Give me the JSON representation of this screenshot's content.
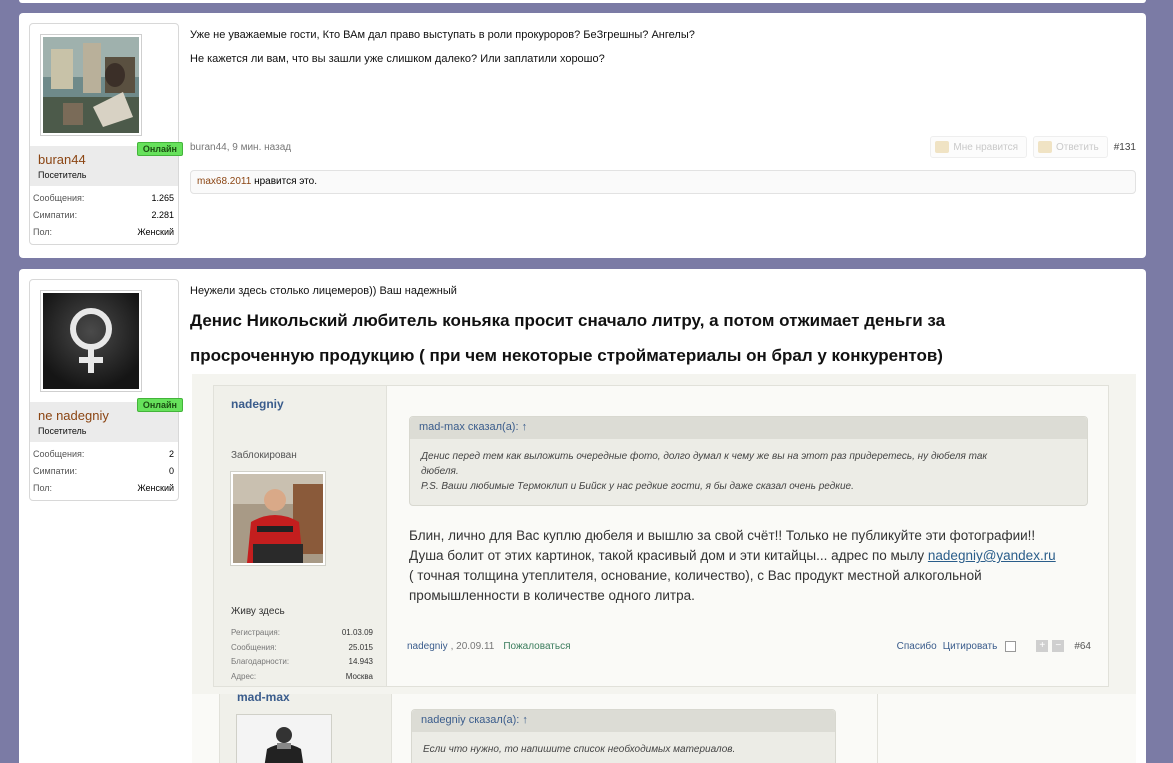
{
  "posts": [
    {
      "user": {
        "name": "buran44",
        "title": "Посетитель",
        "online": "Онлайн",
        "stats": [
          {
            "label": "Сообщения:",
            "value": "1.265"
          },
          {
            "label": "Симпатии:",
            "value": "2.281"
          },
          {
            "label": "Пол:",
            "value": "Женский"
          }
        ]
      },
      "lines": [
        "Уже не уважаемые гости, Кто ВАм дал право выступать в роли прокуроров? БеЗгрешны? Ангелы?",
        "Не кажется ли вам, что вы зашли уже слишком далеко? Или заплатили хорошо?"
      ],
      "meta": "buran44, 9 мин. назад",
      "like_label": "Мне нравится",
      "reply_label": "Ответить",
      "number": "#131",
      "likes": {
        "user": "max68.2011",
        "text": " нравится это."
      }
    },
    {
      "user": {
        "name": "ne nadegniy",
        "title": "Посетитель",
        "online": "Онлайн",
        "stats": [
          {
            "label": "Сообщения:",
            "value": "2"
          },
          {
            "label": "Симпатии:",
            "value": "0"
          },
          {
            "label": "Пол:",
            "value": "Женский"
          }
        ]
      },
      "intro": "Неужели здесь столько лицемеров)) Ваш надежный",
      "bold_lines": [
        "Денис Никольский любитель коньяка просит сначало литру, а потом отжимает деньги за",
        "просроченную продукцию ( при чем некоторые стройматериалы он брал у конкурентов)"
      ]
    }
  ],
  "embedded": {
    "username": "nadegniy",
    "status": "Заблокирован",
    "live": "Живу здесь",
    "stats": [
      {
        "label": "Регистрация:",
        "value": "01.03.09"
      },
      {
        "label": "Сообщения:",
        "value": "25.015"
      },
      {
        "label": "Благодарности:",
        "value": "14.943"
      },
      {
        "label": "Адрес:",
        "value": "Москва"
      }
    ],
    "quote_head": "mad-max сказал(а): ↑",
    "quote_lines": [
      "Денис перед тем как выложить очередные фото, долго думал к чему же вы на этот раз придеретесь, ну дюбеля так",
      "дюбеля.",
      "P.S. Ваши любимые Термоклип и Бийск у нас редкие гости, я бы даже сказал очень редкие."
    ],
    "text1": "Блин, лично для Вас куплю дюбеля и вышлю за свой счёт!! Только не публикуйте эти фотографии!!",
    "text2": "Душа болит от этих картинок, такой красивый дом и эти китайцы... адрес по мылу ",
    "email": "nadegniy@yandex.ru",
    "text3": "( точная толщина утеплителя, основание, количество), с Вас продукт местной алкогольной",
    "text4": "промышленности в количестве одного литра.",
    "foot_author": "nadegniy",
    "foot_date": ", 20.09.11",
    "foot_report": "Пожаловаться",
    "foot_thanks": "Спасибо",
    "foot_quote": "Цитировать",
    "foot_plus": "+",
    "foot_minus": "−",
    "foot_num": "#64"
  },
  "embedded2": {
    "username": "mad-max",
    "quote_head": "nadegniy сказал(а): ↑",
    "quote_line1": "Если что нужно, то напишите список необходимых материалов."
  }
}
